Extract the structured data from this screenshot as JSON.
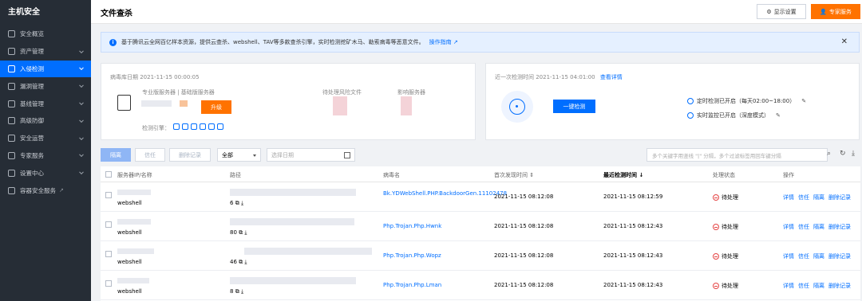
{
  "sidebar": {
    "title": "主机安全",
    "items": [
      {
        "label": "安全概览",
        "icon": "dashboard-icon",
        "chevron": false,
        "active": false
      },
      {
        "label": "资产管理",
        "icon": "assets-icon",
        "chevron": true,
        "active": false
      },
      {
        "label": "入侵检测",
        "icon": "shield-icon",
        "chevron": true,
        "active": true
      },
      {
        "label": "漏洞管理",
        "icon": "bug-icon",
        "chevron": true,
        "active": false
      },
      {
        "label": "基线管理",
        "icon": "baseline-icon",
        "chevron": true,
        "active": false
      },
      {
        "label": "高级防御",
        "icon": "defense-icon",
        "chevron": true,
        "active": false
      },
      {
        "label": "安全运营",
        "icon": "operations-icon",
        "chevron": true,
        "active": false
      },
      {
        "label": "专家服务",
        "icon": "expert-icon",
        "chevron": true,
        "active": false
      },
      {
        "label": "设置中心",
        "icon": "settings-icon",
        "chevron": true,
        "active": false
      },
      {
        "label": "容器安全服务",
        "icon": "container-icon",
        "chevron": false,
        "active": false,
        "external": true
      }
    ]
  },
  "header": {
    "title": "文件查杀",
    "display_settings": "显示设置",
    "expert_service": "专家服务"
  },
  "notice": {
    "text": "基于腾讯云全网百亿样本资源，提供云查杀、webshell、TAV等多款查杀引擎，实时检测挖矿木马、勒索病毒等恶意文件。",
    "link": "操作指南"
  },
  "virus_card": {
    "db_date": "病毒库日期 2021-11-15 00:00:05",
    "server_types": "专业版服务器 | 基础版服务器",
    "upgrade": "升级",
    "engine_label": "检测引擎：",
    "pending_label": "待处理风险文件",
    "affected_label": "影响服务器"
  },
  "scan_card": {
    "last_scan": "近一次检测时间 2021-11-15 04:01:00",
    "view_details": "查看详情",
    "one_click": "一键检测",
    "scheduled": "定时检测已开启（每天02:00~18:00）",
    "realtime": "实时监控已开启（深度模式）"
  },
  "toolbar": {
    "isolate": "隔离",
    "trust": "信任",
    "delete": "删除记录",
    "filter_selected": "全部",
    "date_placeholder": "选择日期",
    "search_placeholder": "多个关键字用竖线 \"|\" 分隔，多个过滤标签用回车键分隔"
  },
  "table": {
    "headers": {
      "server": "服务器IP/名称",
      "path": "路径",
      "virus": "病毒名",
      "first_found": "首次发现时间",
      "last_detected": "最近检测时间",
      "status": "处理状态",
      "ops": "操作"
    },
    "rows": [
      {
        "server_name": "webshell",
        "path_count": "6",
        "virus": "Bk.YDWebShell.PHP.BackdoorGen.11102478",
        "first": "2021-11-15 08:12:08",
        "last": "2021-11-15 08:12:59",
        "status": "待处理"
      },
      {
        "server_name": "webshell",
        "path_count": "80",
        "virus": "Php.Trojan.Php.Hwnk",
        "first": "2021-11-15 08:12:08",
        "last": "2021-11-15 08:12:43",
        "status": "待处理"
      },
      {
        "server_name": "webshell",
        "path_count": "46",
        "virus": "Php.Trojan.Php.Wopz",
        "first": "2021-11-15 08:12:08",
        "last": "2021-11-15 08:12:43",
        "status": "待处理"
      },
      {
        "server_name": "webshell",
        "path_count": "8",
        "virus": "Php.Trojan.Php.Lman",
        "first": "2021-11-15 08:12:08",
        "last": "2021-11-15 08:12:43",
        "status": "待处理"
      }
    ],
    "ops": {
      "detail": "详情",
      "trust": "信任",
      "isolate": "隔离",
      "delete": "删除记录"
    }
  }
}
